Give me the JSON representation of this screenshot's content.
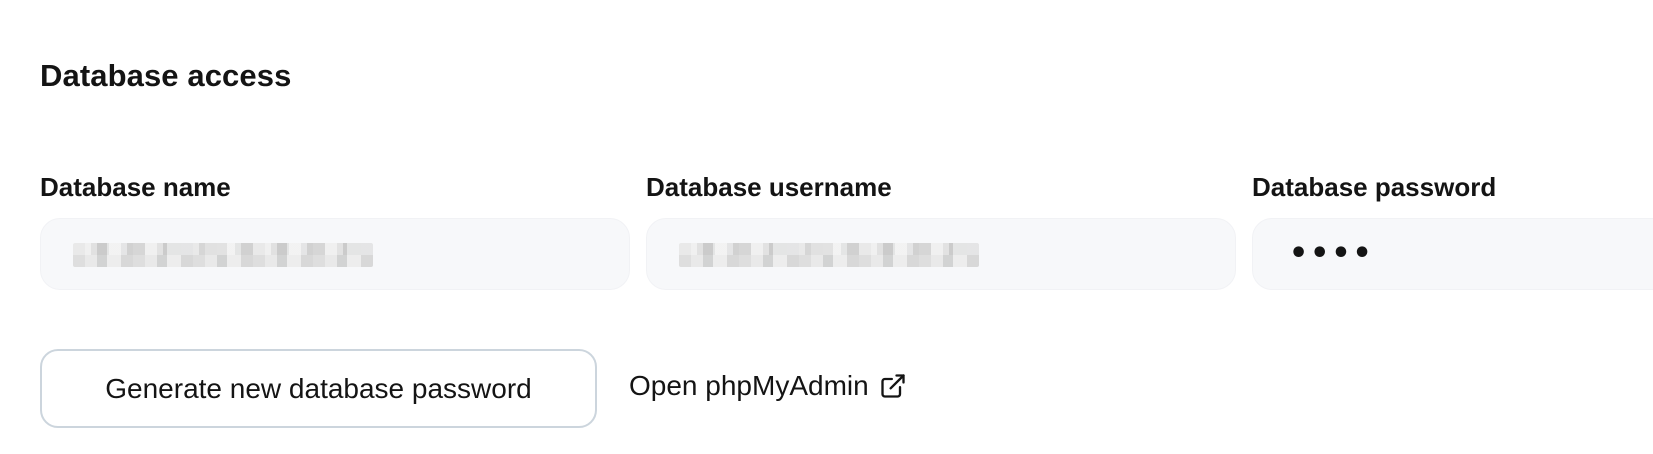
{
  "section": {
    "title": "Database access"
  },
  "fields": {
    "db_name": {
      "label": "Database name"
    },
    "db_username": {
      "label": "Database username"
    },
    "db_password": {
      "label": "Database password",
      "value": "••••"
    }
  },
  "actions": {
    "generate_label": "Generate new database password",
    "phpmyadmin_label": "Open phpMyAdmin",
    "phpmyadmin_icon": "external-link-icon"
  }
}
